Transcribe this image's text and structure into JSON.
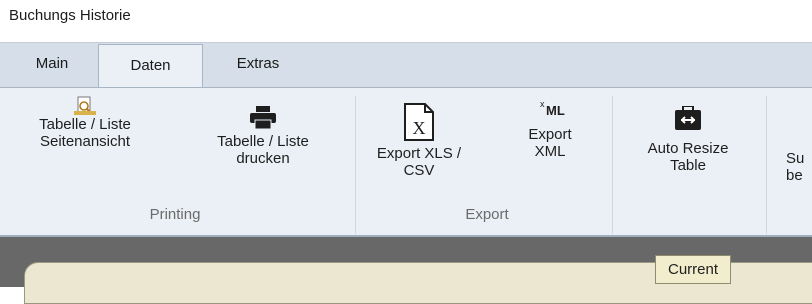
{
  "window": {
    "title": "Buchungs Historie"
  },
  "tabs": [
    {
      "label": "Main",
      "active": false
    },
    {
      "label": "Daten",
      "active": true
    },
    {
      "label": "Extras",
      "active": false
    }
  ],
  "ribbon": {
    "groups": [
      {
        "label": "Printing"
      },
      {
        "label": "Export"
      }
    ],
    "buttons": {
      "preview": {
        "line1": "Tabelle / Liste",
        "line2": "Seitenansicht",
        "icon": "print-preview-icon"
      },
      "print": {
        "line1": "Tabelle / Liste",
        "line2": "drucken",
        "icon": "printer-icon"
      },
      "export_xls": {
        "line1": "Export XLS /",
        "line2": "CSV",
        "icon": "excel-file-icon"
      },
      "export_xml": {
        "line1": "Export",
        "line2": "XML",
        "icon": "xml-icon",
        "icon_text": "ML"
      },
      "auto_resize": {
        "line1": "Auto Resize",
        "line2": "Table",
        "icon": "resize-briefcase-icon"
      },
      "partial": {
        "line1": "Su",
        "line2": "be",
        "icon": ""
      }
    }
  },
  "content": {
    "badge": "Current"
  },
  "colors": {
    "ribbon_bg": "#ebf0f6",
    "tabstrip_bg": "#d5dee9",
    "content_bg": "#686868",
    "panel_bg": "#ebe7d1"
  }
}
